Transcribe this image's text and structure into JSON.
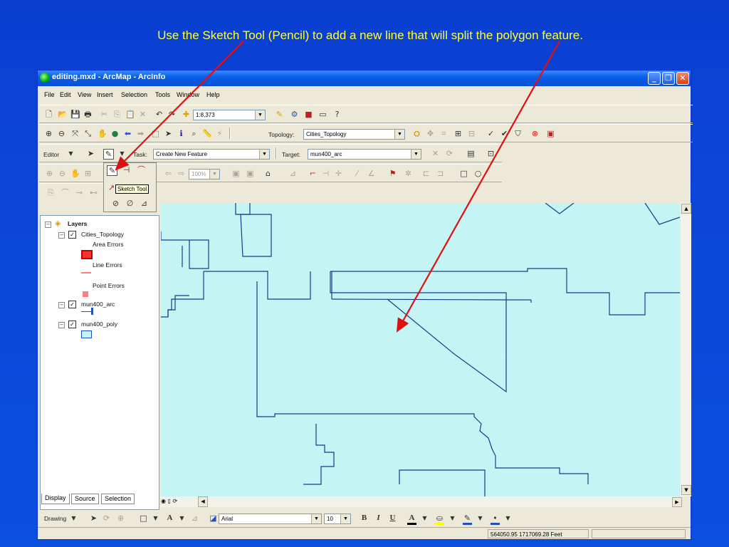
{
  "slide": {
    "caption": "Use the Sketch Tool (Pencil) to add a new line that will split the polygon feature."
  },
  "window": {
    "title": "editing.mxd - ArcMap - ArcInfo",
    "minimize": "_",
    "restore": "❐",
    "close": "✕"
  },
  "menu": [
    "File",
    "Edit",
    "View",
    "Insert",
    "Selection",
    "Tools",
    "Window",
    "Help"
  ],
  "standard_toolbar": {
    "scale": "1:8,373"
  },
  "tools_toolbar": {
    "topology_label": "Topology:",
    "topology_value": "Cities_Topology"
  },
  "editor_toolbar": {
    "editor_label": "Editor",
    "task_label": "Task:",
    "task_value": "Create New Feature",
    "target_label": "Target:",
    "target_value": "mun400_arc"
  },
  "topology_toolbar": {
    "zoom_value": "100%"
  },
  "sketch_popup": {
    "tooltip": "Sketch Tool"
  },
  "toc": {
    "root": "Layers",
    "layers": [
      {
        "name": "Cities_Topology",
        "children": [
          "Area Errors",
          "Line Errors",
          "Point Errors"
        ]
      },
      {
        "name": "mun400_arc"
      },
      {
        "name": "mun400_poly"
      }
    ],
    "tabs": [
      "Display",
      "Source",
      "Selection"
    ]
  },
  "drawing_toolbar": {
    "drawing_label": "Drawing",
    "font": "Arial",
    "font_size": "10",
    "bold": "B",
    "italic": "I",
    "underline": "U"
  },
  "status_bar": {
    "coordinates": "564050.95  1717069.28 Feet"
  },
  "colors": {
    "slide_background": "#0a47d8",
    "caption": "#ffff33",
    "map_fill": "#c4f4f4",
    "map_lines": "#1a3a8a",
    "arrow": "#e01010"
  }
}
